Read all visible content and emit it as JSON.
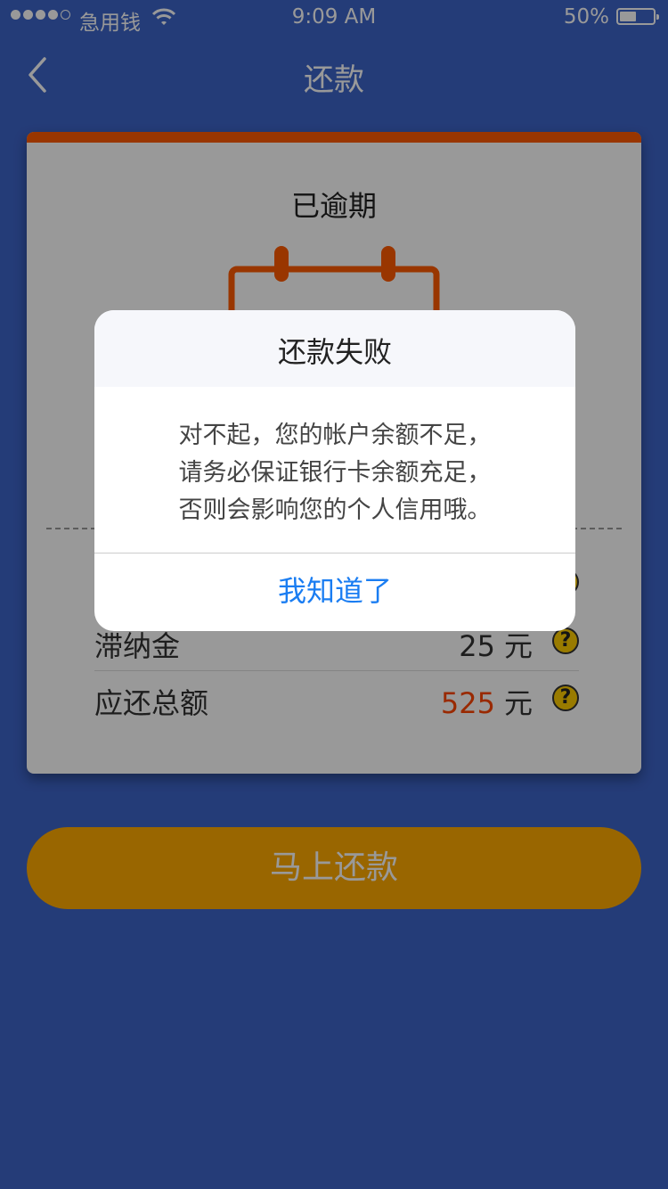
{
  "status_bar": {
    "carrier": "急用钱",
    "time": "9:09 AM",
    "battery_percent": "50%",
    "battery_level": 0.5,
    "signal_bars": 4
  },
  "nav": {
    "title": "还款",
    "back_icon": "chevron-left-icon"
  },
  "card": {
    "status_title": "已逾期",
    "accent_color": "#ff5a00",
    "rows": [
      {
        "label": "",
        "amount": "",
        "unit": ""
      },
      {
        "label": "滞纳金",
        "amount": "25",
        "unit": "元"
      },
      {
        "label": "应还总额",
        "amount": "525",
        "unit": "元"
      }
    ],
    "help_icon": "question-icon"
  },
  "repay_button": {
    "label": "马上还款",
    "color": "#ffaa00"
  },
  "dialog": {
    "title": "还款失败",
    "message_lines": [
      "对不起，您的帐户余额不足，",
      "请务必保证银行卡余额充足，",
      "否则会影响您的个人信用哦。"
    ],
    "confirm_label": "我知道了",
    "confirm_color": "#1a7df2"
  }
}
